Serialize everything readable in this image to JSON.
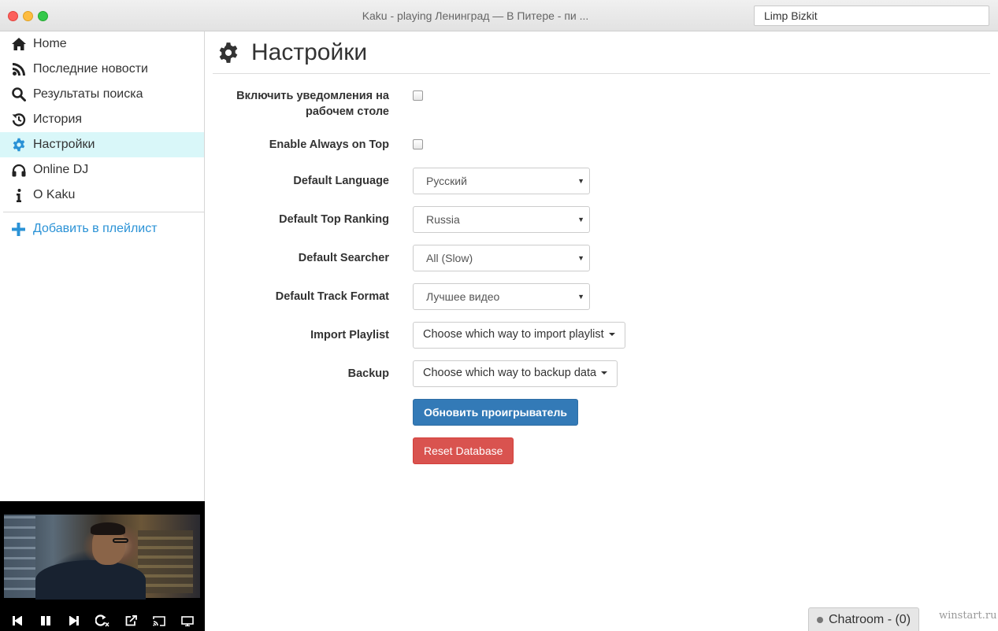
{
  "window": {
    "title": "Kaku - playing Ленинград — В Питере - пи ...",
    "search_value": "Limp Bizkit"
  },
  "sidebar": {
    "items": [
      {
        "label": "Home",
        "icon": "home-icon"
      },
      {
        "label": "Последние новости",
        "icon": "rss-icon"
      },
      {
        "label": "Результаты поиска",
        "icon": "search-icon"
      },
      {
        "label": "История",
        "icon": "history-icon"
      },
      {
        "label": "Настройки",
        "icon": "gear-icon",
        "active": true
      },
      {
        "label": "Online DJ",
        "icon": "headphones-icon"
      },
      {
        "label": "О Kaku",
        "icon": "info-icon"
      }
    ],
    "add_playlist": "Добавить в плейлист"
  },
  "page": {
    "title": "Настройки"
  },
  "settings": {
    "notifications_label": "Включить уведомления на рабочем столе",
    "always_on_top_label": "Enable Always on Top",
    "language_label": "Default Language",
    "language_value": "Русский",
    "ranking_label": "Default Top Ranking",
    "ranking_value": "Russia",
    "searcher_label": "Default Searcher",
    "searcher_value": "All (Slow)",
    "format_label": "Default Track Format",
    "format_value": "Лучшее видео",
    "import_label": "Import Playlist",
    "import_button": "Choose which way to import playlist",
    "backup_label": "Backup",
    "backup_button": "Choose which way to backup data",
    "update_button": "Обновить проигрыватель",
    "reset_button": "Reset Database"
  },
  "chatroom": {
    "label": "Chatroom - (0)"
  },
  "watermark": "winstart.ru",
  "colors": {
    "accent": "#2a92d6",
    "active_bg": "#d9f7f9",
    "primary": "#337ab7",
    "danger": "#d9534f"
  }
}
